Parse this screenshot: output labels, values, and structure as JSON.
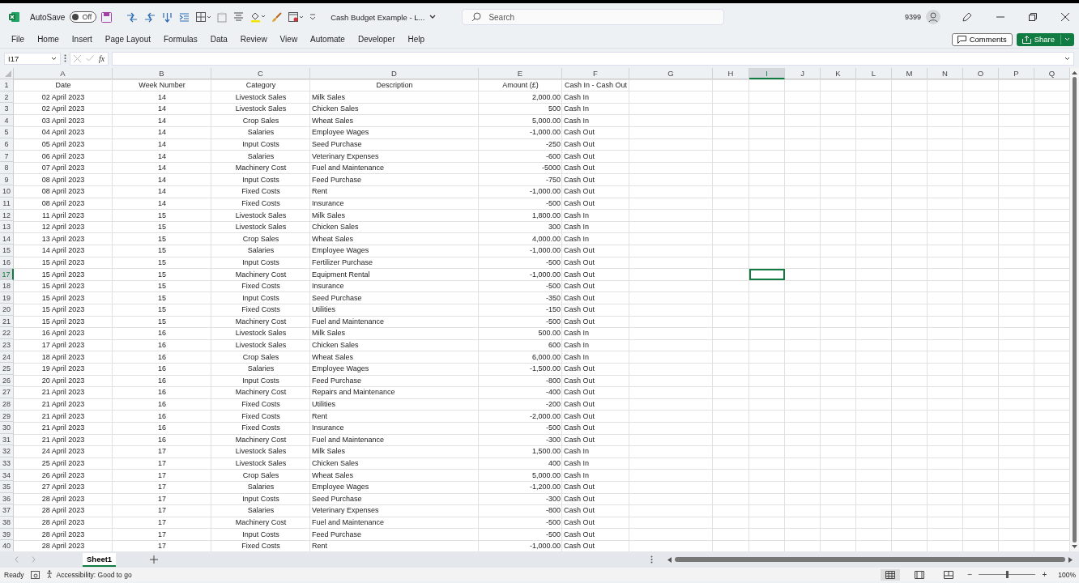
{
  "title_bar": {
    "autosave": {
      "label": "AutoSave",
      "on": false,
      "state_text": "Off"
    },
    "document_title": "Cash Budget Example - L...",
    "search": {
      "placeholder": "Search"
    },
    "user_id": "9399"
  },
  "ribbon_tabs": [
    {
      "label": "File",
      "selected": false
    },
    {
      "label": "Home",
      "selected": false
    },
    {
      "label": "Insert",
      "selected": false
    },
    {
      "label": "Page Layout",
      "selected": false
    },
    {
      "label": "Formulas",
      "selected": false
    },
    {
      "label": "Data",
      "selected": false
    },
    {
      "label": "Review",
      "selected": false
    },
    {
      "label": "View",
      "selected": false
    },
    {
      "label": "Automate",
      "selected": false
    },
    {
      "label": "Developer",
      "selected": false
    },
    {
      "label": "Help",
      "selected": false
    }
  ],
  "ribbon_buttons": [
    "Comments",
    "Share"
  ],
  "formula_bar": {
    "name_box": "I17",
    "fx": "fx"
  },
  "columns": [
    {
      "label": "A",
      "selected": false
    },
    {
      "label": "B",
      "selected": false
    },
    {
      "label": "C",
      "selected": false
    },
    {
      "label": "D",
      "selected": false
    },
    {
      "label": "E",
      "selected": false
    },
    {
      "label": "F",
      "selected": false
    },
    {
      "label": "G",
      "selected": false
    },
    {
      "label": "H",
      "selected": false
    },
    {
      "label": "I",
      "selected": true
    },
    {
      "label": "J",
      "selected": false
    },
    {
      "label": "K",
      "selected": false
    },
    {
      "label": "L",
      "selected": false
    },
    {
      "label": "M",
      "selected": false
    },
    {
      "label": "N",
      "selected": false
    },
    {
      "label": "O",
      "selected": false
    },
    {
      "label": "P",
      "selected": false
    },
    {
      "label": "Q",
      "selected": false
    }
  ],
  "rows": [
    {
      "num": "1",
      "selected": false,
      "cells": [
        "Date",
        "Week Number",
        "Category",
        "Description",
        "Amount (£)",
        "Cash In - Cash Out"
      ]
    },
    {
      "num": "2",
      "selected": false,
      "cells": [
        "02 April 2023",
        "14",
        "Livestock Sales",
        "Milk Sales",
        "2,000.00",
        "Cash In"
      ]
    },
    {
      "num": "3",
      "selected": false,
      "cells": [
        "02 April 2023",
        "14",
        "Livestock Sales",
        "Chicken Sales",
        "500",
        "Cash In"
      ]
    },
    {
      "num": "4",
      "selected": false,
      "cells": [
        "03 April 2023",
        "14",
        "Crop Sales",
        "Wheat Sales",
        "5,000.00",
        "Cash In"
      ]
    },
    {
      "num": "5",
      "selected": false,
      "cells": [
        "04 April 2023",
        "14",
        "Salaries",
        "Employee Wages",
        "-1,000.00",
        "Cash Out"
      ]
    },
    {
      "num": "6",
      "selected": false,
      "cells": [
        "05 April 2023",
        "14",
        "Input Costs",
        "Seed Purchase",
        "-250",
        "Cash Out"
      ]
    },
    {
      "num": "7",
      "selected": false,
      "cells": [
        "06 April 2023",
        "14",
        "Salaries",
        "Veterinary Expenses",
        "-600",
        "Cash Out"
      ]
    },
    {
      "num": "8",
      "selected": false,
      "cells": [
        "07 April 2023",
        "14",
        "Machinery Cost",
        "Fuel and Maintenance",
        "-5000",
        "Cash Out"
      ]
    },
    {
      "num": "9",
      "selected": false,
      "cells": [
        "08 April 2023",
        "14",
        "Input Costs",
        "Feed Purchase",
        "-750",
        "Cash Out"
      ]
    },
    {
      "num": "10",
      "selected": false,
      "cells": [
        "08 April 2023",
        "14",
        "Fixed Costs",
        "Rent",
        "-1,000.00",
        "Cash Out"
      ]
    },
    {
      "num": "11",
      "selected": false,
      "cells": [
        "08 April 2023",
        "14",
        "Fixed Costs",
        "Insurance",
        "-500",
        "Cash Out"
      ]
    },
    {
      "num": "12",
      "selected": false,
      "cells": [
        "11 April 2023",
        "15",
        "Livestock Sales",
        "Milk Sales",
        "1,800.00",
        "Cash In"
      ]
    },
    {
      "num": "13",
      "selected": false,
      "cells": [
        "12 April 2023",
        "15",
        "Livestock Sales",
        "Chicken Sales",
        "300",
        "Cash In"
      ]
    },
    {
      "num": "14",
      "selected": false,
      "cells": [
        "13 April 2023",
        "15",
        "Crop Sales",
        "Wheat Sales",
        "4,000.00",
        "Cash In"
      ]
    },
    {
      "num": "15",
      "selected": false,
      "cells": [
        "14 April 2023",
        "15",
        "Salaries",
        "Employee Wages",
        "-1,000.00",
        "Cash Out"
      ]
    },
    {
      "num": "16",
      "selected": false,
      "cells": [
        "15 April 2023",
        "15",
        "Input Costs",
        "Fertilizer Purchase",
        "-500",
        "Cash Out"
      ]
    },
    {
      "num": "17",
      "selected": true,
      "cells": [
        "15 April 2023",
        "15",
        "Machinery Cost",
        "Equipment Rental",
        "-1,000.00",
        "Cash Out"
      ]
    },
    {
      "num": "18",
      "selected": false,
      "cells": [
        "15 April 2023",
        "15",
        "Fixed Costs",
        "Insurance",
        "-500",
        "Cash Out"
      ]
    },
    {
      "num": "19",
      "selected": false,
      "cells": [
        "15 April 2023",
        "15",
        "Input Costs",
        "Seed Purchase",
        "-350",
        "Cash Out"
      ]
    },
    {
      "num": "20",
      "selected": false,
      "cells": [
        "15 April 2023",
        "15",
        "Fixed Costs",
        "Utilities",
        "-150",
        "Cash Out"
      ]
    },
    {
      "num": "21",
      "selected": false,
      "cells": [
        "15 April 2023",
        "15",
        "Machinery Cost",
        "Fuel and Maintenance",
        "-500",
        "Cash Out"
      ]
    },
    {
      "num": "22",
      "selected": false,
      "cells": [
        "16 April 2023",
        "16",
        "Livestock Sales",
        "Milk Sales",
        "500.00",
        "Cash In"
      ]
    },
    {
      "num": "23",
      "selected": false,
      "cells": [
        "17 April 2023",
        "16",
        "Livestock Sales",
        "Chicken Sales",
        "600",
        "Cash In"
      ]
    },
    {
      "num": "24",
      "selected": false,
      "cells": [
        "18 April 2023",
        "16",
        "Crop Sales",
        "Wheat Sales",
        "6,000.00",
        "Cash In"
      ]
    },
    {
      "num": "25",
      "selected": false,
      "cells": [
        "19 April 2023",
        "16",
        "Salaries",
        "Employee Wages",
        "-1,500.00",
        "Cash Out"
      ]
    },
    {
      "num": "26",
      "selected": false,
      "cells": [
        "20 April 2023",
        "16",
        "Input Costs",
        "Feed Purchase",
        "-800",
        "Cash Out"
      ]
    },
    {
      "num": "27",
      "selected": false,
      "cells": [
        "21 April 2023",
        "16",
        "Machinery Cost",
        "Repairs and Maintenance",
        "-400",
        "Cash Out"
      ]
    },
    {
      "num": "28",
      "selected": false,
      "cells": [
        "21 April 2023",
        "16",
        "Fixed Costs",
        "Utilities",
        "-200",
        "Cash Out"
      ]
    },
    {
      "num": "29",
      "selected": false,
      "cells": [
        "21 April 2023",
        "16",
        "Fixed Costs",
        "Rent",
        "-2,000.00",
        "Cash Out"
      ]
    },
    {
      "num": "30",
      "selected": false,
      "cells": [
        "21 April 2023",
        "16",
        "Fixed Costs",
        "Insurance",
        "-500",
        "Cash Out"
      ]
    },
    {
      "num": "31",
      "selected": false,
      "cells": [
        "21 April 2023",
        "16",
        "Machinery Cost",
        "Fuel and Maintenance",
        "-300",
        "Cash Out"
      ]
    },
    {
      "num": "32",
      "selected": false,
      "cells": [
        "24 April 2023",
        "17",
        "Livestock Sales",
        "Milk Sales",
        "1,500.00",
        "Cash In"
      ]
    },
    {
      "num": "33",
      "selected": false,
      "cells": [
        "25 April 2023",
        "17",
        "Livestock Sales",
        "Chicken Sales",
        "400",
        "Cash In"
      ]
    },
    {
      "num": "34",
      "selected": false,
      "cells": [
        "26 April 2023",
        "17",
        "Crop Sales",
        "Wheat Sales",
        "5,000.00",
        "Cash In"
      ]
    },
    {
      "num": "35",
      "selected": false,
      "cells": [
        "27 April 2023",
        "17",
        "Salaries",
        "Employee Wages",
        "-1,200.00",
        "Cash Out"
      ]
    },
    {
      "num": "36",
      "selected": false,
      "cells": [
        "28 April 2023",
        "17",
        "Input Costs",
        "Seed Purchase",
        "-300",
        "Cash Out"
      ]
    },
    {
      "num": "37",
      "selected": false,
      "cells": [
        "28 April 2023",
        "17",
        "Salaries",
        "Veterinary Expenses",
        "-800",
        "Cash Out"
      ]
    },
    {
      "num": "38",
      "selected": false,
      "cells": [
        "28 April 2023",
        "17",
        "Machinery Cost",
        "Fuel and Maintenance",
        "-500",
        "Cash Out"
      ]
    },
    {
      "num": "39",
      "selected": false,
      "cells": [
        "28 April 2023",
        "17",
        "Input Costs",
        "Feed Purchase",
        "-500",
        "Cash Out"
      ]
    },
    {
      "num": "40",
      "selected": false,
      "cells": [
        "28 April 2023",
        "17",
        "Fixed Costs",
        "Rent",
        "-1,000.00",
        "Cash Out"
      ]
    }
  ],
  "sheet_tabs": [
    {
      "label": "Sheet1",
      "selected": true
    }
  ],
  "status_bar": {
    "status": "Ready",
    "accessibility": "Accessibility: Good to go",
    "views": [
      {
        "kind": "normal",
        "selected": true
      },
      {
        "kind": "page-layout",
        "selected": false
      },
      {
        "kind": "page-break",
        "selected": false
      }
    ],
    "zoom": {
      "minus": "−",
      "plus": "+",
      "level": 0.5,
      "reading": "100%"
    }
  }
}
